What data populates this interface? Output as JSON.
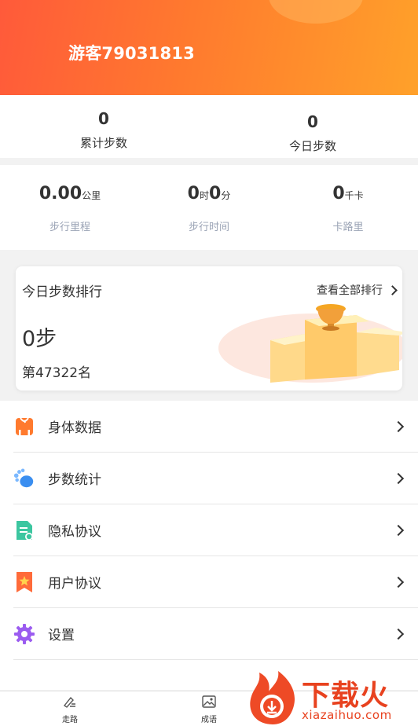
{
  "profile": {
    "username": "游客79031813"
  },
  "steps_summary": {
    "total": {
      "value": "0",
      "label": "累计步数"
    },
    "today": {
      "value": "0",
      "label": "今日步数"
    }
  },
  "stats": {
    "distance": {
      "value": "0.00",
      "unit": "公里",
      "label": "步行里程"
    },
    "time": {
      "hours": "0",
      "hours_unit": "时",
      "minutes": "0",
      "minutes_unit": "分",
      "label": "步行时间"
    },
    "calories": {
      "value": "0",
      "unit": "千卡",
      "label": "卡路里"
    }
  },
  "ranking": {
    "title": "今日步数排行",
    "view_all": "查看全部排行",
    "steps": "0步",
    "rank": "第47322名"
  },
  "menu": [
    {
      "label": "身体数据",
      "icon": "scale-icon"
    },
    {
      "label": "步数统计",
      "icon": "footprint-icon"
    },
    {
      "label": "隐私协议",
      "icon": "document-icon"
    },
    {
      "label": "用户协议",
      "icon": "bookmark-star-icon"
    },
    {
      "label": "设置",
      "icon": "gear-icon"
    }
  ],
  "tabbar": [
    {
      "label": "走路",
      "icon": "walk-icon"
    },
    {
      "label": "成语",
      "icon": "image-icon"
    }
  ],
  "watermark": {
    "text": "下载火",
    "url": "xiazaihuo.com"
  },
  "colors": {
    "header_start": "#ff5a3a",
    "header_end": "#ffa12a",
    "muted_label": "#9aa3b5",
    "watermark": "#e8421f"
  }
}
